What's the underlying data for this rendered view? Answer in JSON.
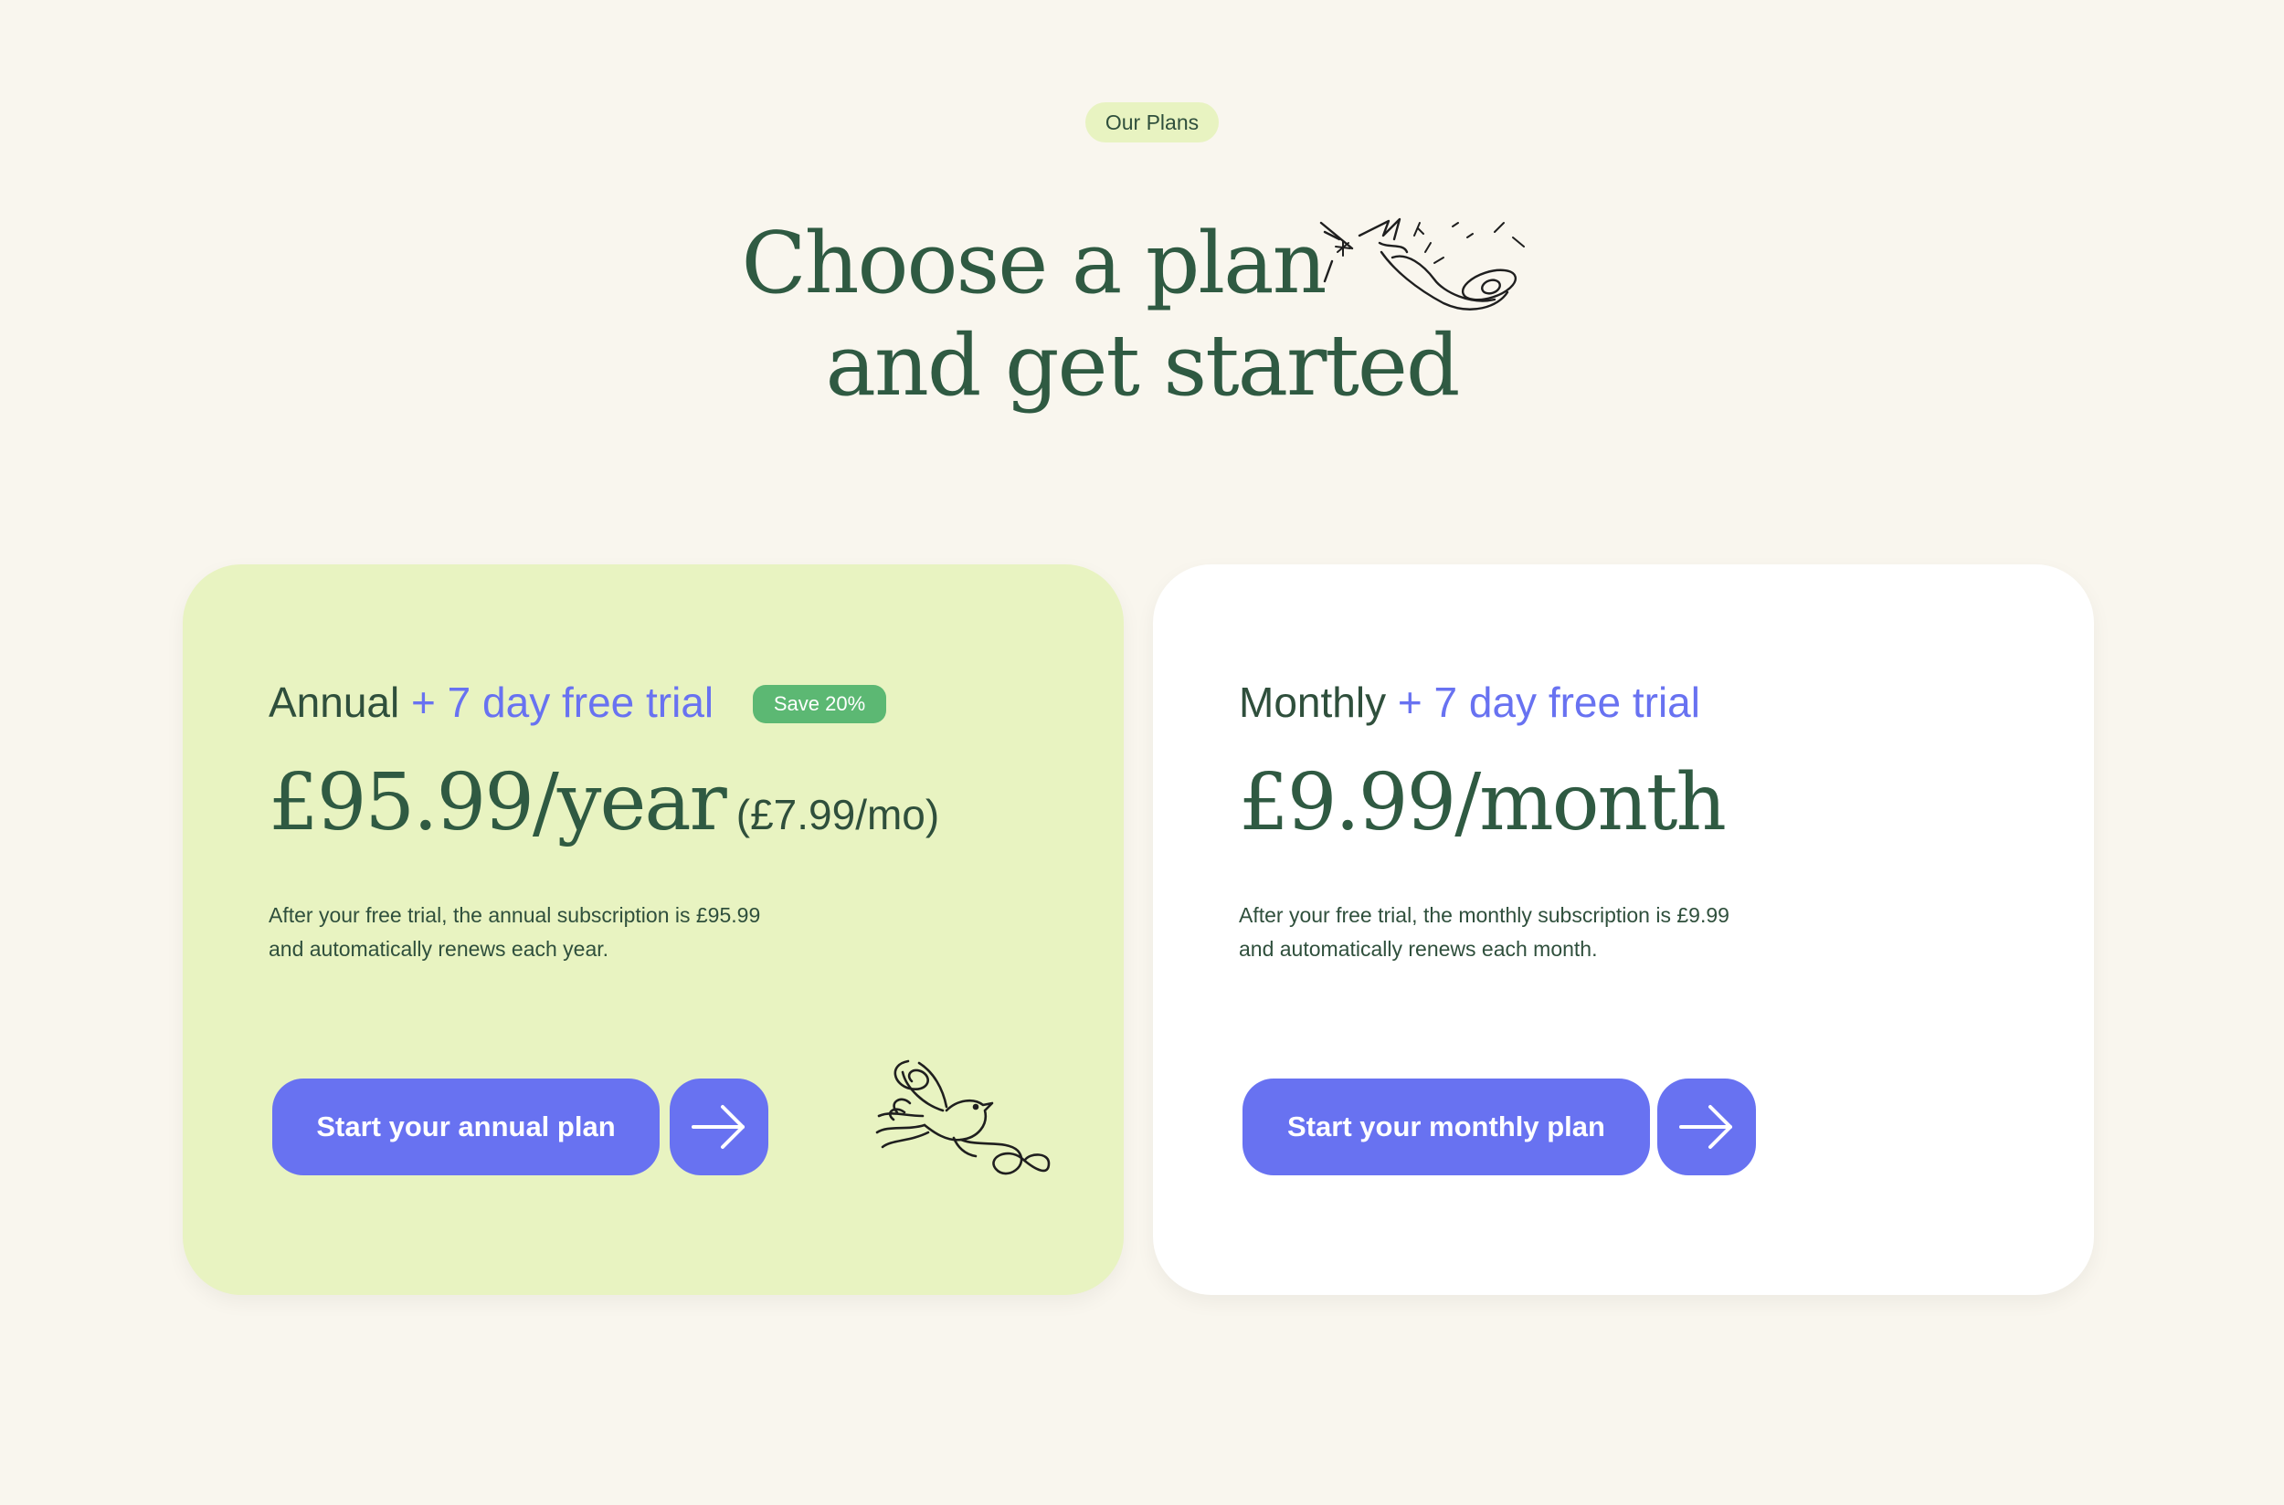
{
  "header": {
    "eyebrow": "Our Plans",
    "headline_line1": "Choose a plan",
    "headline_line2": "and  get started"
  },
  "plans": {
    "annual": {
      "name": "Annual",
      "trial": "+ 7 day free trial",
      "badge": "Save 20%",
      "price": "£95.99/year",
      "price_per_month": "(£7.99/mo)",
      "description_line1": "After your free trial, the annual subscription is £95.99",
      "description_line2": "and automatically renews each year.",
      "cta_label": "Start your annual plan",
      "arrow_icon": "arrow-right-icon"
    },
    "monthly": {
      "name": "Monthly",
      "trial": "+ 7 day free trial",
      "price": "£9.99/month",
      "description_line1": "After your free trial, the monthly subscription is £9.99",
      "description_line2": "and automatically renews each month.",
      "cta_label": "Start your monthly plan",
      "arrow_icon": "arrow-right-icon"
    }
  },
  "colors": {
    "page_background": "#f9f6ee",
    "annual_card": "#e8f3c1",
    "monthly_card": "#ffffff",
    "accent": "#6872f1",
    "heading_green": "#2f5a42",
    "badge_green": "#5cb873"
  }
}
